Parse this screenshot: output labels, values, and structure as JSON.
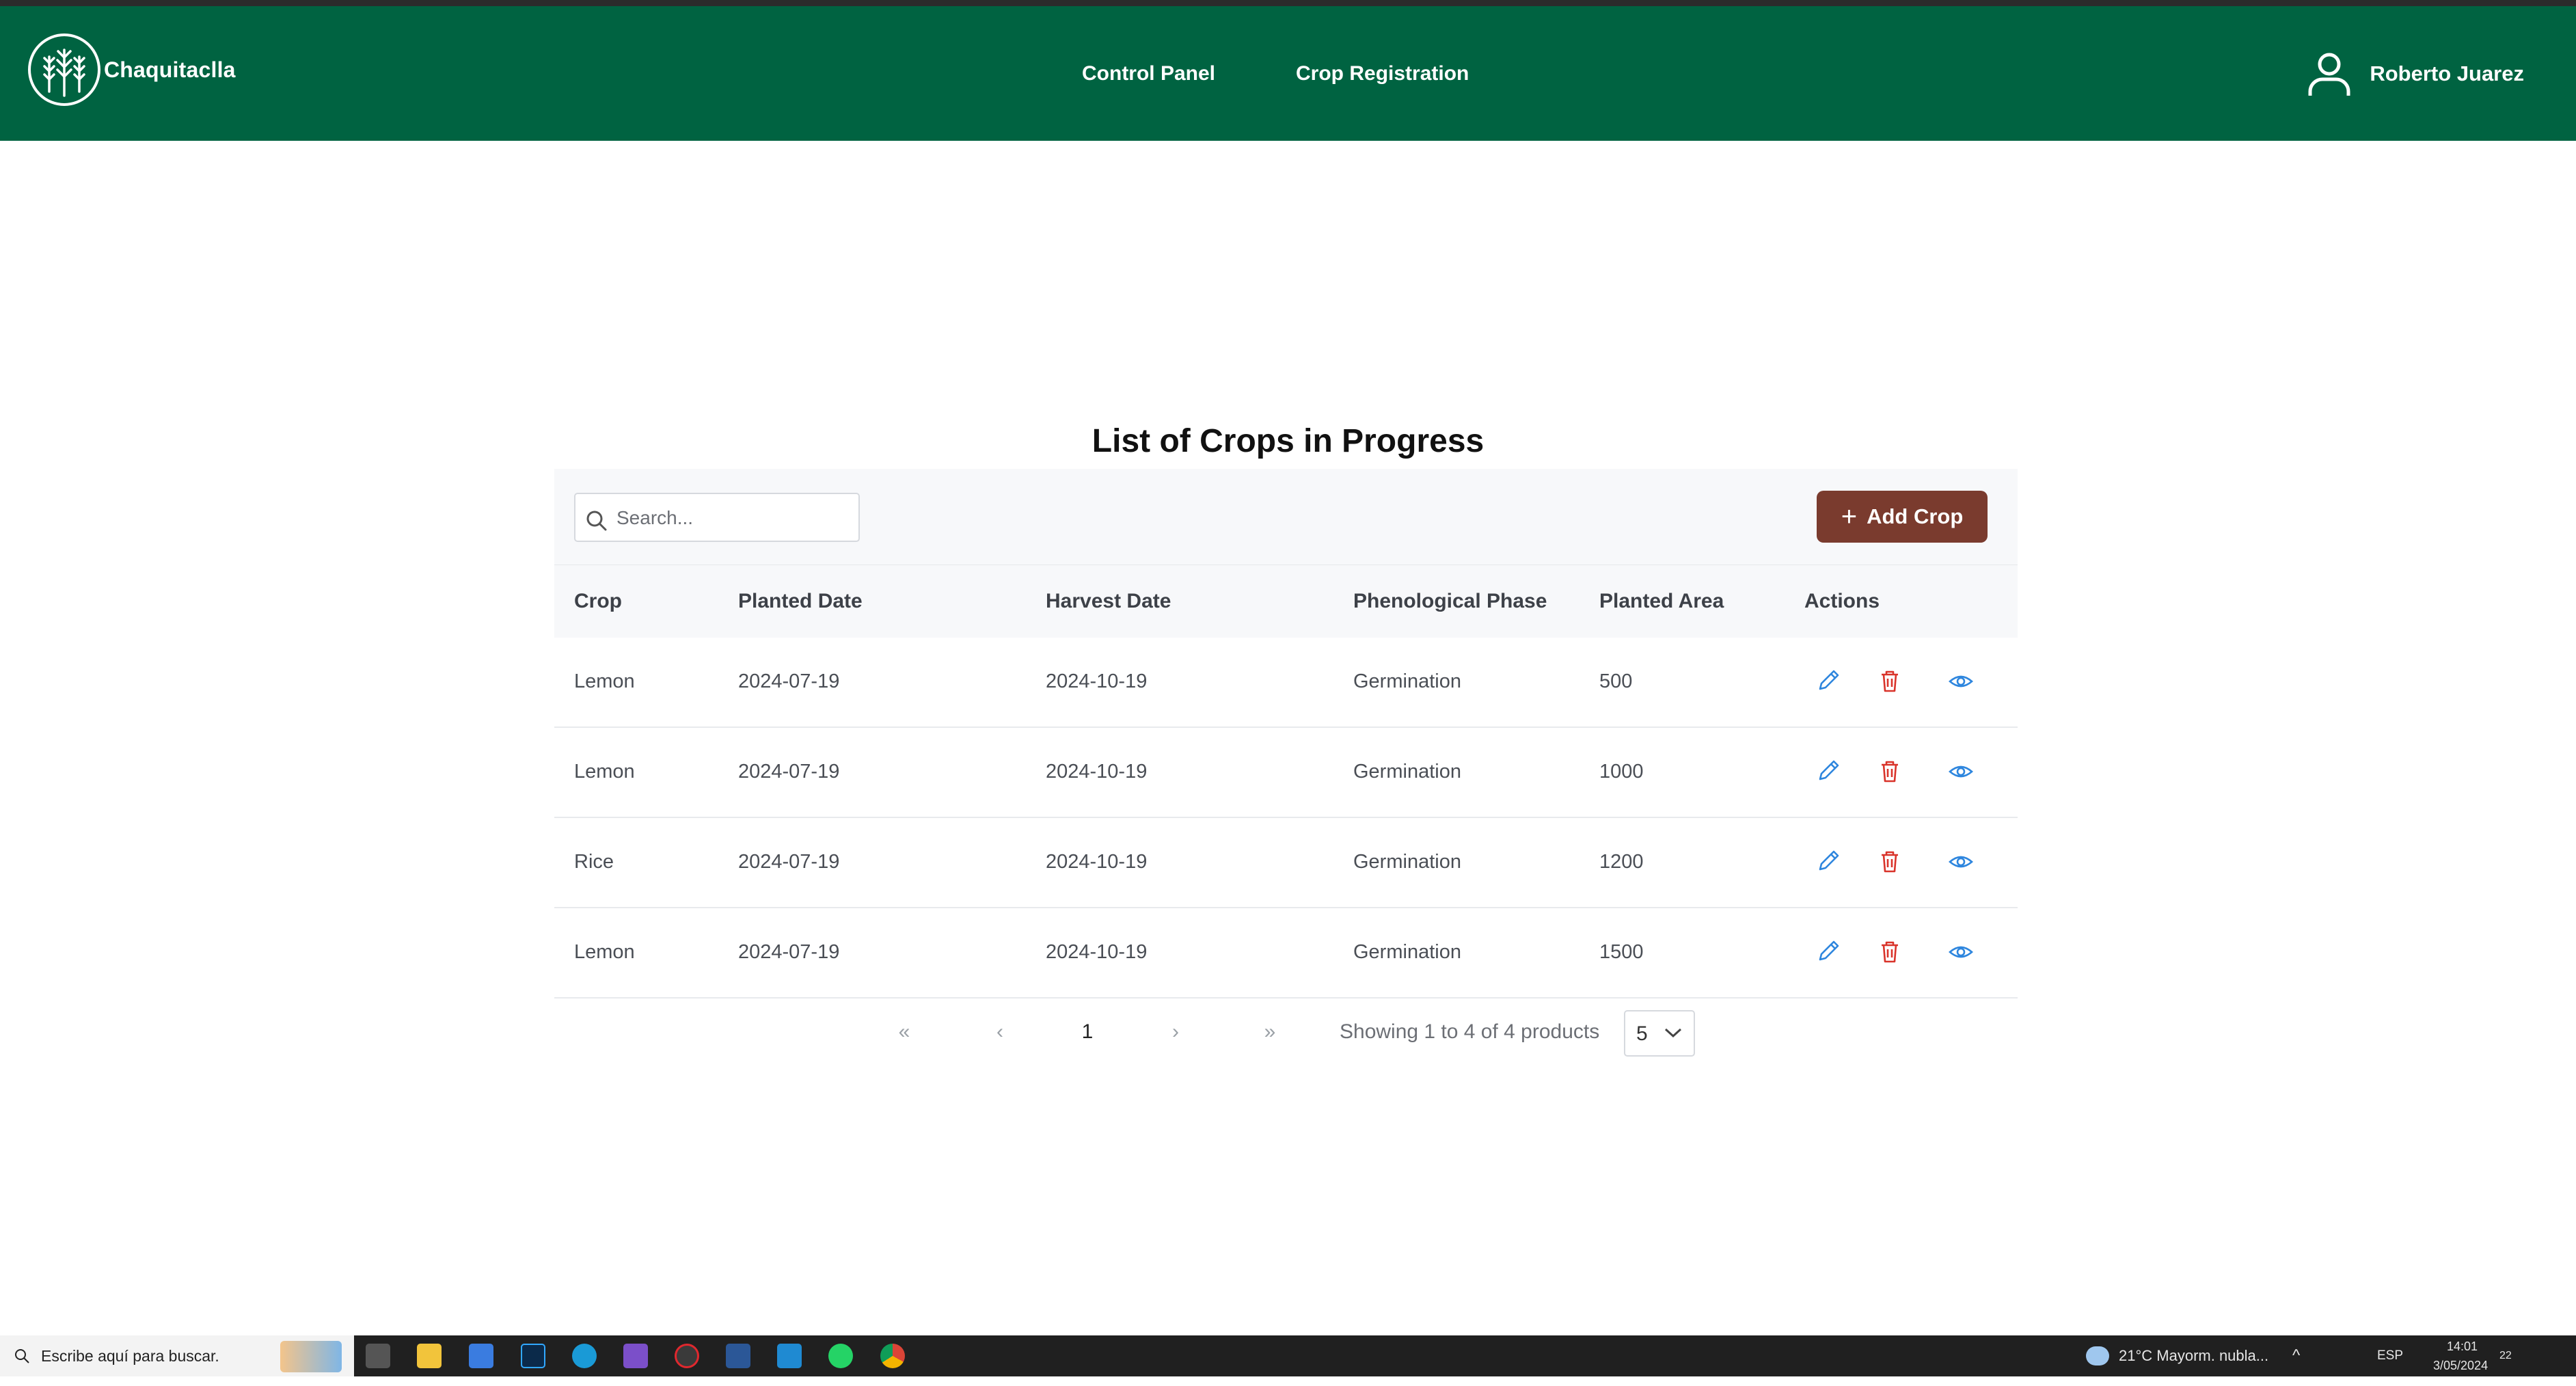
{
  "colors": {
    "nav_bg": "#006341",
    "primary_button": "#7a3b2e",
    "edit_icon": "#2e86de",
    "delete_icon": "#d9342b",
    "view_icon": "#2e86de",
    "taskbar_bg": "#202020"
  },
  "navbar": {
    "brand": "Chaquitaclla",
    "links": [
      "Control Panel",
      "Crop Registration"
    ],
    "user_name": "Roberto Juarez"
  },
  "page": {
    "title": "List of Crops in Progress"
  },
  "toolbar": {
    "search_placeholder": "Search...",
    "add_label": "Add Crop"
  },
  "table": {
    "columns": [
      "Crop",
      "Planted Date",
      "Harvest Date",
      "Phenological Phase",
      "Planted Area",
      "Actions"
    ],
    "rows": [
      {
        "crop": "Lemon",
        "planted": "2024-07-19",
        "harvest": "2024-10-19",
        "phase": "Germination",
        "area": "500"
      },
      {
        "crop": "Lemon",
        "planted": "2024-07-19",
        "harvest": "2024-10-19",
        "phase": "Germination",
        "area": "1000"
      },
      {
        "crop": "Rice",
        "planted": "2024-07-19",
        "harvest": "2024-10-19",
        "phase": "Germination",
        "area": "1200"
      },
      {
        "crop": "Lemon",
        "planted": "2024-07-19",
        "harvest": "2024-10-19",
        "phase": "Germination",
        "area": "1500"
      }
    ],
    "action_icons": [
      "edit-icon",
      "trash-icon",
      "eye-icon"
    ]
  },
  "pagination": {
    "first": "«",
    "prev": "‹",
    "page": "1",
    "next": "›",
    "last": "»",
    "info": "Showing 1 to 4 of 4 products",
    "page_size": "5"
  },
  "taskbar": {
    "search_placeholder": "Escribe aquí para buscar.",
    "weather": "21°C  Mayorm. nubla...",
    "language": "ESP",
    "time": "14:01",
    "date": "3/05/2024",
    "notifications": "22"
  }
}
